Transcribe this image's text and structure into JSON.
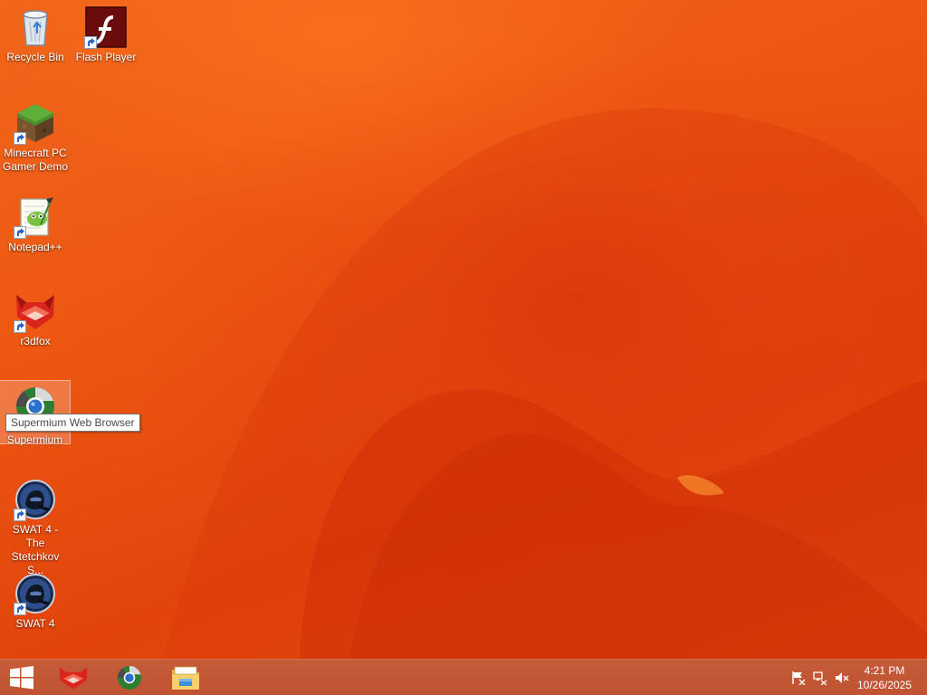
{
  "desktop_icons": [
    {
      "label": "Recycle Bin",
      "icon": "recycle-bin-icon"
    },
    {
      "label": "Flash Player",
      "icon": "flash-player-icon"
    },
    {
      "label": "Minecraft PC Gamer Demo",
      "icon": "minecraft-icon"
    },
    {
      "label": "Notepad++",
      "icon": "notepad-plus-plus-icon"
    },
    {
      "label": "r3dfox",
      "icon": "r3dfox-icon"
    },
    {
      "label": "Supermium",
      "icon": "supermium-icon"
    },
    {
      "label": "SWAT 4 - The Stetchkov S...",
      "icon": "swat4-icon"
    },
    {
      "label": "SWAT 4",
      "icon": "swat4-icon"
    }
  ],
  "tooltip": {
    "text": "Supermium Web Browser"
  },
  "taskbar": {
    "pinned": [
      {
        "name": "r3dfox",
        "icon": "r3dfox-icon"
      },
      {
        "name": "Supermium",
        "icon": "supermium-icon"
      },
      {
        "name": "File Explorer",
        "icon": "file-explorer-icon"
      }
    ],
    "tray_icons": [
      "action-center-flag-icon",
      "network-icon",
      "volume-muted-icon"
    ],
    "clock": {
      "time": "4:21 PM",
      "date": "10/26/2025"
    }
  },
  "colors": {
    "wallpaper": "#ec5411",
    "taskbar": "#c45836",
    "selection": "rgba(255,255,255,0.22)"
  }
}
